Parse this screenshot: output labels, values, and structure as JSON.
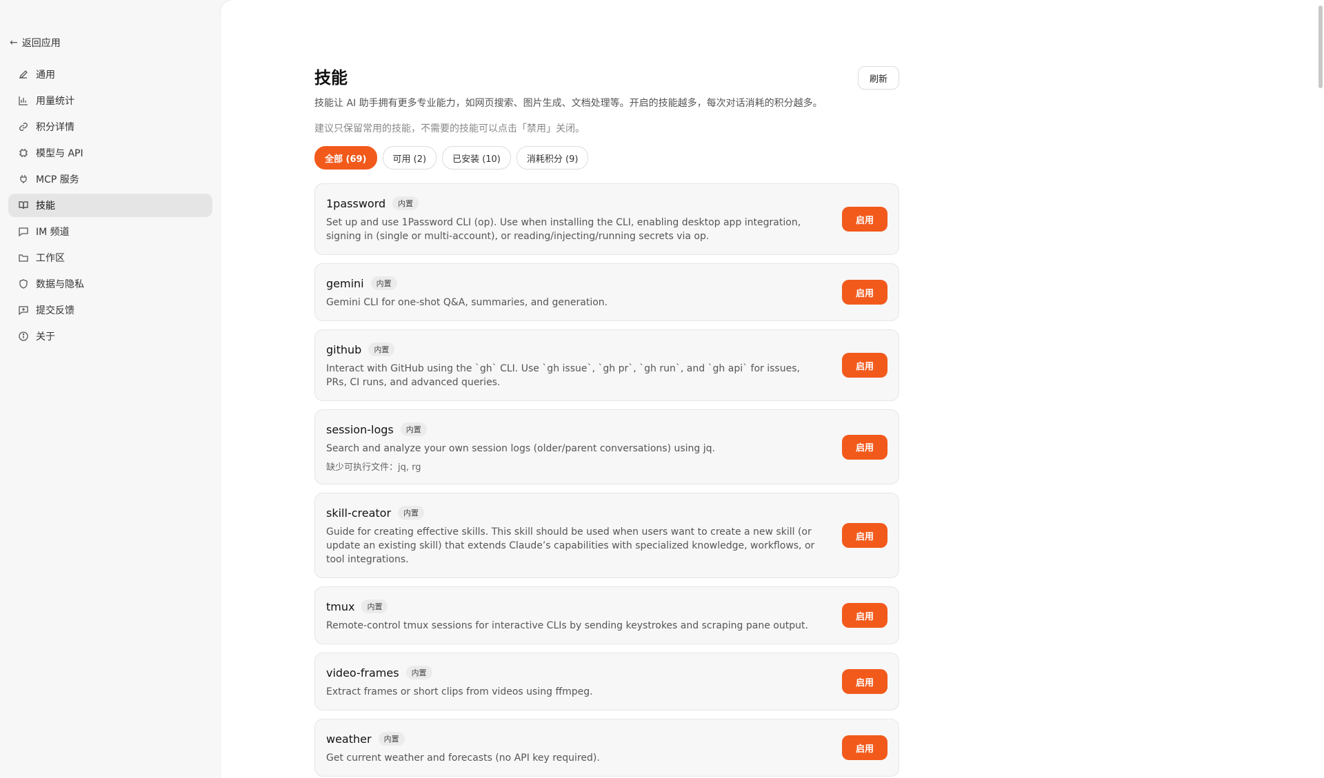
{
  "sidebar": {
    "back_label": "返回应用",
    "items": [
      {
        "label": "通用",
        "icon": "pencil-icon"
      },
      {
        "label": "用量统计",
        "icon": "bar-chart-icon"
      },
      {
        "label": "积分详情",
        "icon": "link-icon"
      },
      {
        "label": "模型与 API",
        "icon": "cpu-icon"
      },
      {
        "label": "MCP 服务",
        "icon": "plug-icon"
      },
      {
        "label": "技能",
        "icon": "book-icon",
        "active": true
      },
      {
        "label": "IM 频道",
        "icon": "message-icon"
      },
      {
        "label": "工作区",
        "icon": "folder-icon"
      },
      {
        "label": "数据与隐私",
        "icon": "shield-icon"
      },
      {
        "label": "提交反馈",
        "icon": "feedback-icon"
      },
      {
        "label": "关于",
        "icon": "info-icon"
      }
    ]
  },
  "main": {
    "title": "技能",
    "refresh_label": "刷新",
    "description": "技能让 AI 助手拥有更多专业能力，如网页搜索、图片生成、文档处理等。开启的技能越多，每次对话消耗的积分越多。",
    "hint": "建议只保留常用的技能，不需要的技能可以点击「禁用」关闭。",
    "filters": [
      {
        "label": "全部 (69)",
        "active": true
      },
      {
        "label": "可用 (2)"
      },
      {
        "label": "已安装 (10)"
      },
      {
        "label": "消耗积分 (9)"
      }
    ],
    "skills": [
      {
        "name": "1password",
        "badge": "内置",
        "description": "Set up and use 1Password CLI (op). Use when installing the CLI, enabling desktop app integration, signing in (single or multi-account), or reading/injecting/running secrets via op.",
        "note": "",
        "action": "启用"
      },
      {
        "name": "gemini",
        "badge": "内置",
        "description": "Gemini CLI for one-shot Q&A, summaries, and generation.",
        "note": "",
        "action": "启用"
      },
      {
        "name": "github",
        "badge": "内置",
        "description": "Interact with GitHub using the `gh` CLI. Use `gh issue`, `gh pr`, `gh run`, and `gh api` for issues, PRs, CI runs, and advanced queries.",
        "note": "",
        "action": "启用"
      },
      {
        "name": "session-logs",
        "badge": "内置",
        "description": "Search and analyze your own session logs (older/parent conversations) using jq.",
        "note": "缺少可执行文件：jq, rg",
        "action": "启用"
      },
      {
        "name": "skill-creator",
        "badge": "内置",
        "description": "Guide for creating effective skills. This skill should be used when users want to create a new skill (or update an existing skill) that extends Claude’s capabilities with specialized knowledge, workflows, or tool integrations.",
        "note": "",
        "action": "启用"
      },
      {
        "name": "tmux",
        "badge": "内置",
        "description": "Remote-control tmux sessions for interactive CLIs by sending keystrokes and scraping pane output.",
        "note": "",
        "action": "启用"
      },
      {
        "name": "video-frames",
        "badge": "内置",
        "description": "Extract frames or short clips from videos using ffmpeg.",
        "note": "",
        "action": "启用"
      },
      {
        "name": "weather",
        "badge": "内置",
        "description": "Get current weather and forecasts (no API key required).",
        "note": "",
        "action": "启用"
      }
    ]
  }
}
